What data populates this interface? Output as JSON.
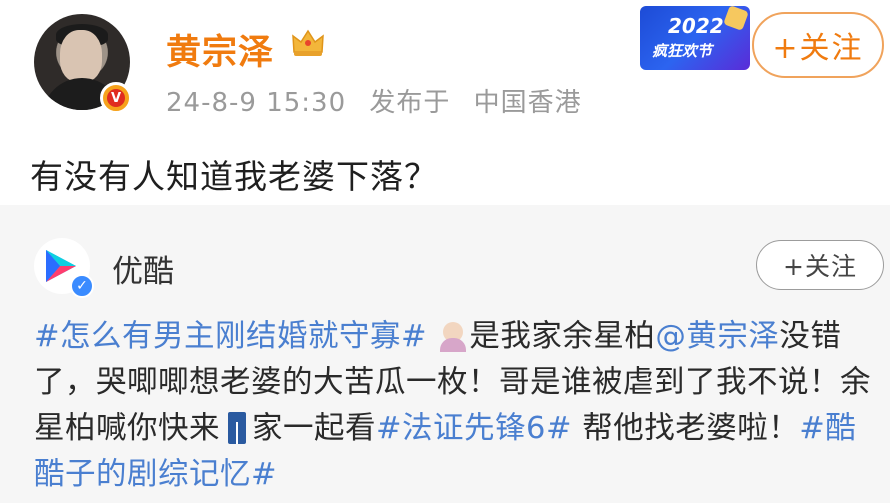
{
  "post": {
    "author": "黄宗泽",
    "date": "24-8-9 15:30",
    "source": "发布于",
    "location": "中国香港",
    "follow_label": "+关注",
    "text": "有没有人知道我老婆下落？"
  },
  "promo": {
    "year": "2022",
    "title": "疯狂欢节"
  },
  "repost": {
    "author": "优酷",
    "follow_label": "+关注",
    "hashtag1": "#怎么有男主刚结婚就守寡#",
    "text1": "是我家余星柏",
    "mention": "@黄宗泽",
    "text2": "没错了，哭唧唧想老婆的大苦瓜一枚！哥是谁被虐到了我不说！余星柏喊你快来",
    "text3": "家一起看",
    "hashtag2": "#法证先锋6#",
    "text4": " 帮他找老婆啦！",
    "hashtag3": "#酷酷子的剧综记忆#"
  },
  "icons": {
    "verified_badge": "verified-v-icon",
    "crown": "crown-icon",
    "emoji1": "person-raising-hand-emoji",
    "emoji2": "jeans-emoji"
  },
  "colors": {
    "author_name": "#f07b0f",
    "link": "#4a7fd0",
    "repost_bg": "#f6f6f6"
  }
}
